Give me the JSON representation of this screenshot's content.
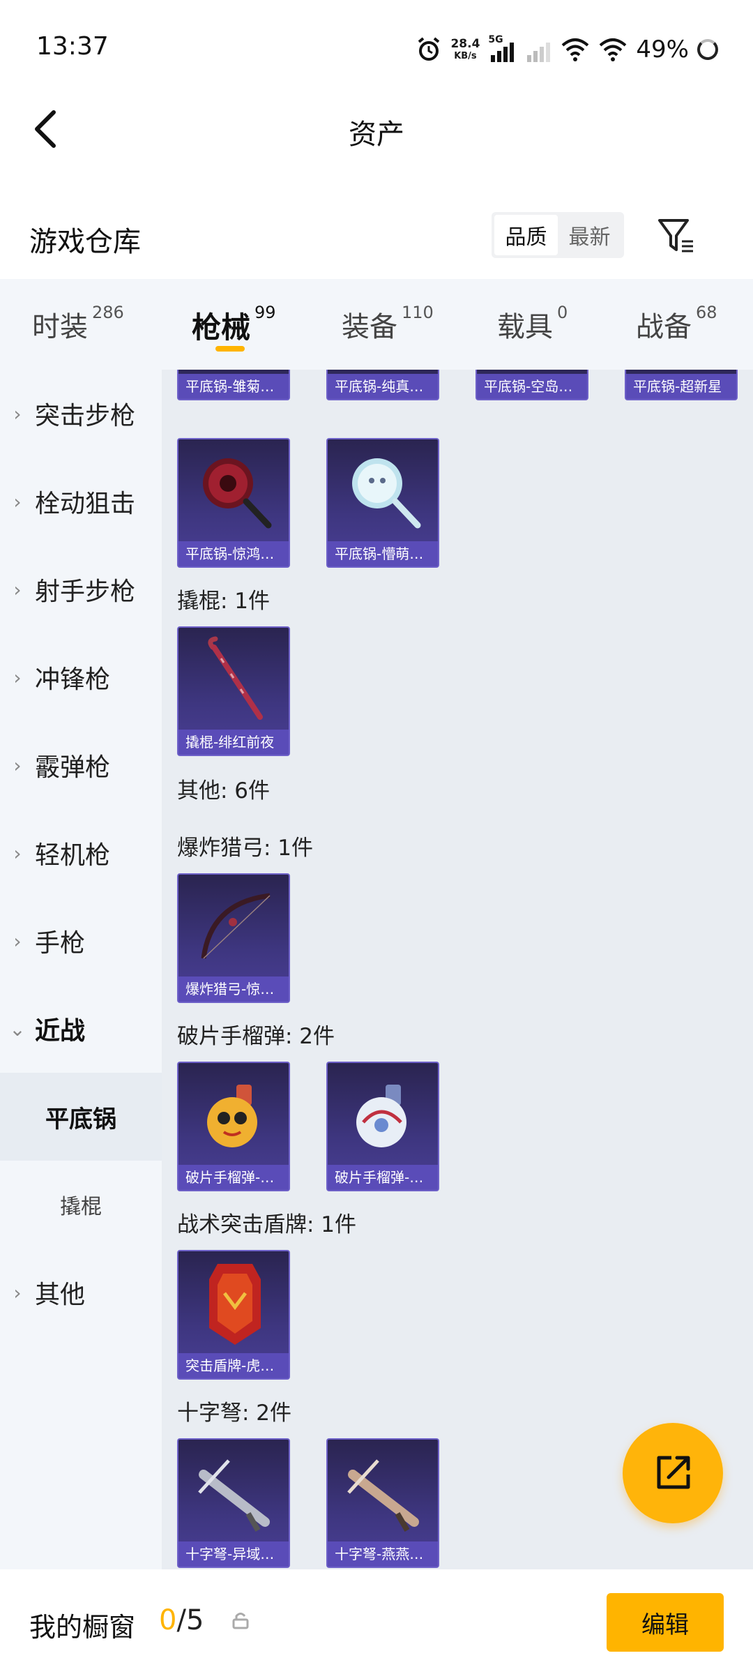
{
  "status_bar": {
    "time": "13:37",
    "net_speed_value": "28.4",
    "net_speed_unit": "KB/s",
    "network": "5G",
    "battery": "49%"
  },
  "header": {
    "title": "资产"
  },
  "warehouse": {
    "title": "游戏仓库",
    "sort_options": [
      "品质",
      "最新"
    ],
    "active_sort": "品质"
  },
  "tabs": [
    {
      "label": "时装",
      "count": "286"
    },
    {
      "label": "枪械",
      "count": "99",
      "active": true
    },
    {
      "label": "装备",
      "count": "110"
    },
    {
      "label": "载具",
      "count": "0"
    },
    {
      "label": "战备",
      "count": "68"
    }
  ],
  "sidebar": {
    "items": [
      {
        "label": "突击步枪"
      },
      {
        "label": "栓动狙击"
      },
      {
        "label": "射手步枪"
      },
      {
        "label": "冲锋枪"
      },
      {
        "label": "霰弹枪"
      },
      {
        "label": "轻机枪"
      },
      {
        "label": "手枪"
      },
      {
        "label": "近战"
      },
      {
        "label": "其他"
      }
    ],
    "sub_items": [
      {
        "label": "平底锅",
        "selected": true
      },
      {
        "label": "撬棍"
      }
    ]
  },
  "content": {
    "top_row_captions": [
      "平底锅-雏菊…",
      "平底锅-纯真…",
      "平底锅-空岛…",
      "平底锅-超新星"
    ],
    "pan_row_captions": [
      "平底锅-惊鸿…",
      "平底锅-懵萌…"
    ],
    "groups": {
      "crowbar": {
        "label": "撬棍: 1件",
        "captions": [
          "撬棍-绯红前夜"
        ]
      },
      "other": {
        "label": "其他: 6件"
      },
      "bow": {
        "label": "爆炸猎弓: 1件",
        "captions": [
          "爆炸猎弓-惊…"
        ]
      },
      "grenade": {
        "label": "破片手榴弹: 2件",
        "captions": [
          "破片手榴弹-…",
          "破片手榴弹-…"
        ]
      },
      "shield": {
        "label": "战术突击盾牌: 1件",
        "captions": [
          "突击盾牌-虎…"
        ]
      },
      "crossbow": {
        "label": "十字弩: 2件",
        "captions": [
          "十字弩-异域…",
          "十字弩-燕燕…"
        ]
      }
    }
  },
  "bottom_bar": {
    "label": "我的橱窗",
    "current": "0",
    "separator": "/",
    "max": "5",
    "edit_label": "编辑"
  },
  "colors": {
    "accent": "#ffb400",
    "card_caption": "#5a4cb8",
    "card_bg": "#3e3680",
    "content_bg": "#e9edf2",
    "sidebar_bg": "#f3f6fa"
  }
}
